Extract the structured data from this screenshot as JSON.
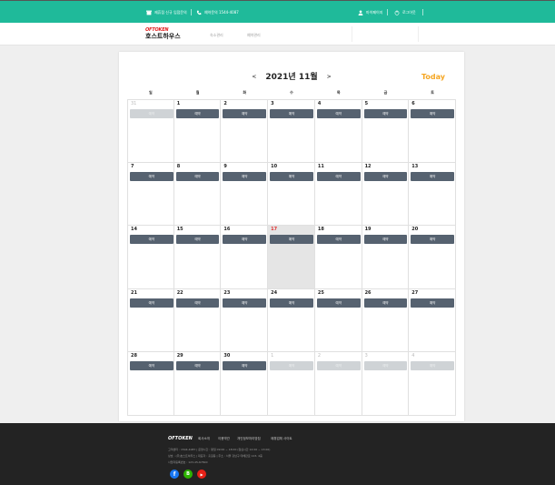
{
  "topbar": {
    "partner_label": "제휴점 신규 입점문의",
    "phone_label": "예약문의 1544-4087",
    "mypage_label": "마이페이지",
    "logout_label": "로그아웃"
  },
  "header": {
    "logo_brand": "OFTOKEN",
    "logo_name": "호스트하우스",
    "nav": [
      "숙소관리",
      "예약관리"
    ]
  },
  "calendar": {
    "prev_label": "<",
    "next_label": ">",
    "title": "2021년 11월",
    "today_label": "Today",
    "weekdays": [
      "일",
      "월",
      "화",
      "수",
      "목",
      "금",
      "토"
    ],
    "reserve_label": "예약",
    "weeks": [
      [
        {
          "day": "31",
          "dim": true,
          "active": false
        },
        {
          "day": "1",
          "dim": false,
          "active": true
        },
        {
          "day": "2",
          "dim": false,
          "active": true
        },
        {
          "day": "3",
          "dim": false,
          "active": true
        },
        {
          "day": "4",
          "dim": false,
          "active": true
        },
        {
          "day": "5",
          "dim": false,
          "active": true
        },
        {
          "day": "6",
          "dim": false,
          "active": true
        }
      ],
      [
        {
          "day": "7",
          "dim": false,
          "active": true
        },
        {
          "day": "8",
          "dim": false,
          "active": true
        },
        {
          "day": "9",
          "dim": false,
          "active": true
        },
        {
          "day": "10",
          "dim": false,
          "active": true
        },
        {
          "day": "11",
          "dim": false,
          "active": true
        },
        {
          "day": "12",
          "dim": false,
          "active": true
        },
        {
          "day": "13",
          "dim": false,
          "active": true
        }
      ],
      [
        {
          "day": "14",
          "dim": false,
          "active": true
        },
        {
          "day": "15",
          "dim": false,
          "active": true
        },
        {
          "day": "16",
          "dim": false,
          "active": true
        },
        {
          "day": "17",
          "dim": false,
          "active": true,
          "today": true
        },
        {
          "day": "18",
          "dim": false,
          "active": true
        },
        {
          "day": "19",
          "dim": false,
          "active": true
        },
        {
          "day": "20",
          "dim": false,
          "active": true
        }
      ],
      [
        {
          "day": "21",
          "dim": false,
          "active": true
        },
        {
          "day": "22",
          "dim": false,
          "active": true
        },
        {
          "day": "23",
          "dim": false,
          "active": true
        },
        {
          "day": "24",
          "dim": false,
          "active": true
        },
        {
          "day": "25",
          "dim": false,
          "active": true
        },
        {
          "day": "26",
          "dim": false,
          "active": true
        },
        {
          "day": "27",
          "dim": false,
          "active": true
        }
      ],
      [
        {
          "day": "28",
          "dim": false,
          "active": true
        },
        {
          "day": "29",
          "dim": false,
          "active": true
        },
        {
          "day": "30",
          "dim": false,
          "active": true
        },
        {
          "day": "1",
          "dim": true,
          "active": false
        },
        {
          "day": "2",
          "dim": true,
          "active": false
        },
        {
          "day": "3",
          "dim": true,
          "active": false
        },
        {
          "day": "4",
          "dim": true,
          "active": false
        }
      ]
    ]
  },
  "footer": {
    "logo": "OFTOKEN",
    "links": [
      "회사소개",
      "이용약관",
      "개인정보처리방침",
      "제휴업체 사이트"
    ],
    "info_lines": [
      "고객센터 : 1544-4087  |  운영시간 : 평일 09:00 ~ 18:00 (점심시간 12:00 ~ 13:00)",
      "상호 : (주)호스트하우스  |  대표자 : 홍길동  |  주소 : 서울 강남구 테헤란로 123, 4층",
      "사업자등록번호 : 123-45-67890"
    ],
    "social": [
      "f",
      "B",
      "▶"
    ]
  },
  "colors": {
    "topbar": "#1fba9a",
    "reserve": "#566270",
    "reserve_disabled": "#cfd3d6",
    "today_accent": "#f5a623",
    "footer": "#232323"
  }
}
